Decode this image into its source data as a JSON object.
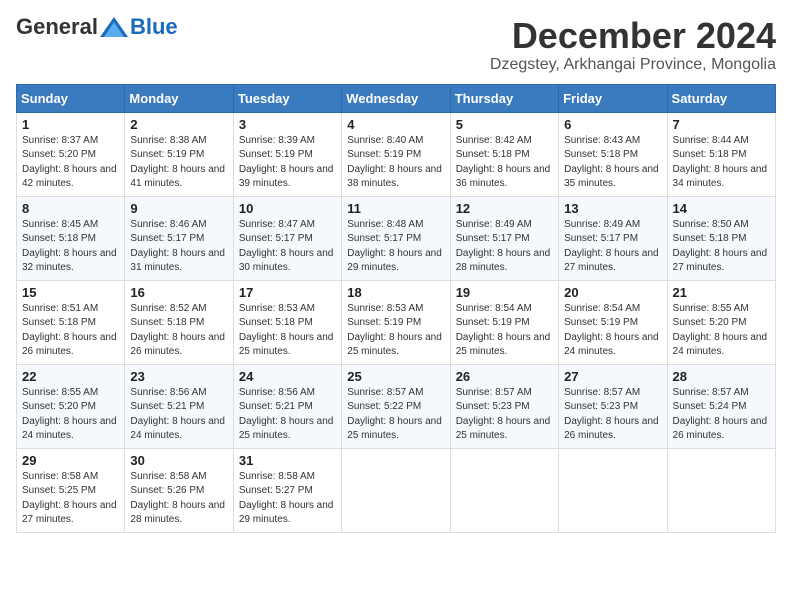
{
  "logo": {
    "general": "General",
    "blue": "Blue"
  },
  "title": "December 2024",
  "subtitle": "Dzegstey, Arkhangai Province, Mongolia",
  "days_of_week": [
    "Sunday",
    "Monday",
    "Tuesday",
    "Wednesday",
    "Thursday",
    "Friday",
    "Saturday"
  ],
  "weeks": [
    [
      {
        "day": "1",
        "sunrise": "8:37 AM",
        "sunset": "5:20 PM",
        "daylight": "8 hours and 42 minutes."
      },
      {
        "day": "2",
        "sunrise": "8:38 AM",
        "sunset": "5:19 PM",
        "daylight": "8 hours and 41 minutes."
      },
      {
        "day": "3",
        "sunrise": "8:39 AM",
        "sunset": "5:19 PM",
        "daylight": "8 hours and 39 minutes."
      },
      {
        "day": "4",
        "sunrise": "8:40 AM",
        "sunset": "5:19 PM",
        "daylight": "8 hours and 38 minutes."
      },
      {
        "day": "5",
        "sunrise": "8:42 AM",
        "sunset": "5:18 PM",
        "daylight": "8 hours and 36 minutes."
      },
      {
        "day": "6",
        "sunrise": "8:43 AM",
        "sunset": "5:18 PM",
        "daylight": "8 hours and 35 minutes."
      },
      {
        "day": "7",
        "sunrise": "8:44 AM",
        "sunset": "5:18 PM",
        "daylight": "8 hours and 34 minutes."
      }
    ],
    [
      {
        "day": "8",
        "sunrise": "8:45 AM",
        "sunset": "5:18 PM",
        "daylight": "8 hours and 32 minutes."
      },
      {
        "day": "9",
        "sunrise": "8:46 AM",
        "sunset": "5:17 PM",
        "daylight": "8 hours and 31 minutes."
      },
      {
        "day": "10",
        "sunrise": "8:47 AM",
        "sunset": "5:17 PM",
        "daylight": "8 hours and 30 minutes."
      },
      {
        "day": "11",
        "sunrise": "8:48 AM",
        "sunset": "5:17 PM",
        "daylight": "8 hours and 29 minutes."
      },
      {
        "day": "12",
        "sunrise": "8:49 AM",
        "sunset": "5:17 PM",
        "daylight": "8 hours and 28 minutes."
      },
      {
        "day": "13",
        "sunrise": "8:49 AM",
        "sunset": "5:17 PM",
        "daylight": "8 hours and 27 minutes."
      },
      {
        "day": "14",
        "sunrise": "8:50 AM",
        "sunset": "5:18 PM",
        "daylight": "8 hours and 27 minutes."
      }
    ],
    [
      {
        "day": "15",
        "sunrise": "8:51 AM",
        "sunset": "5:18 PM",
        "daylight": "8 hours and 26 minutes."
      },
      {
        "day": "16",
        "sunrise": "8:52 AM",
        "sunset": "5:18 PM",
        "daylight": "8 hours and 26 minutes."
      },
      {
        "day": "17",
        "sunrise": "8:53 AM",
        "sunset": "5:18 PM",
        "daylight": "8 hours and 25 minutes."
      },
      {
        "day": "18",
        "sunrise": "8:53 AM",
        "sunset": "5:19 PM",
        "daylight": "8 hours and 25 minutes."
      },
      {
        "day": "19",
        "sunrise": "8:54 AM",
        "sunset": "5:19 PM",
        "daylight": "8 hours and 25 minutes."
      },
      {
        "day": "20",
        "sunrise": "8:54 AM",
        "sunset": "5:19 PM",
        "daylight": "8 hours and 24 minutes."
      },
      {
        "day": "21",
        "sunrise": "8:55 AM",
        "sunset": "5:20 PM",
        "daylight": "8 hours and 24 minutes."
      }
    ],
    [
      {
        "day": "22",
        "sunrise": "8:55 AM",
        "sunset": "5:20 PM",
        "daylight": "8 hours and 24 minutes."
      },
      {
        "day": "23",
        "sunrise": "8:56 AM",
        "sunset": "5:21 PM",
        "daylight": "8 hours and 24 minutes."
      },
      {
        "day": "24",
        "sunrise": "8:56 AM",
        "sunset": "5:21 PM",
        "daylight": "8 hours and 25 minutes."
      },
      {
        "day": "25",
        "sunrise": "8:57 AM",
        "sunset": "5:22 PM",
        "daylight": "8 hours and 25 minutes."
      },
      {
        "day": "26",
        "sunrise": "8:57 AM",
        "sunset": "5:23 PM",
        "daylight": "8 hours and 25 minutes."
      },
      {
        "day": "27",
        "sunrise": "8:57 AM",
        "sunset": "5:23 PM",
        "daylight": "8 hours and 26 minutes."
      },
      {
        "day": "28",
        "sunrise": "8:57 AM",
        "sunset": "5:24 PM",
        "daylight": "8 hours and 26 minutes."
      }
    ],
    [
      {
        "day": "29",
        "sunrise": "8:58 AM",
        "sunset": "5:25 PM",
        "daylight": "8 hours and 27 minutes."
      },
      {
        "day": "30",
        "sunrise": "8:58 AM",
        "sunset": "5:26 PM",
        "daylight": "8 hours and 28 minutes."
      },
      {
        "day": "31",
        "sunrise": "8:58 AM",
        "sunset": "5:27 PM",
        "daylight": "8 hours and 29 minutes."
      },
      null,
      null,
      null,
      null
    ]
  ]
}
